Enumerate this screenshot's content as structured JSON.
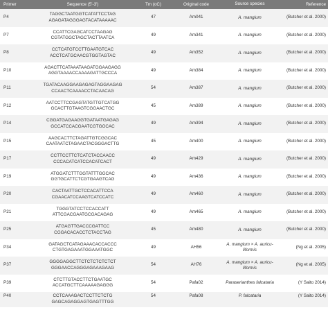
{
  "headers": {
    "primer": "Primer",
    "sequence": "Sequence (5'-3')",
    "tm": "Tm (oC)",
    "code": "Original code",
    "species": "Source species",
    "reference": "Reference"
  },
  "rows": [
    {
      "primer": "P4",
      "seq1": "TAGGCTAATGGTCATATTCCTAG",
      "seq2": "AGAGATAGGGAGTACATAAAAAC",
      "tm": "47",
      "code": "Am041",
      "species": "A. mangium",
      "ref": "(Butcher et al. 2000)"
    },
    {
      "primer": "P7",
      "seq1": "CCATTCGAGCATCCTAAGAG",
      "seq2": "CGTATGGCTAGCTACTTAATCA",
      "tm": "49",
      "code": "Am341",
      "species": "A. mangium",
      "ref": "(Butcher et al. 2000)"
    },
    {
      "primer": "P8",
      "seq1": "CCTCATGTCCTTGAATGTCAC",
      "seq2": "ACCTCATGCAACGTGGTAGTAC",
      "tm": "49",
      "code": "Am352",
      "species": "A. mangium",
      "ref": "(Butcher et al. 2000)"
    },
    {
      "primer": "P10",
      "seq1": "AGACTTCATAAATAAGATGGAAGAGG",
      "seq2": "AGGTAAAACCAAAAGATTGCCCA",
      "tm": "49",
      "code": "Am384",
      "species": "A. mangium",
      "ref": "(Butcher et al. 2000)"
    },
    {
      "primer": "P11",
      "seq1": "TGATACAAGGAAGAGAGTAGGAAGAG",
      "seq2": "CCAACTCAAAACCTACAACAG",
      "tm": "54",
      "code": "Am387",
      "species": "A. mangium",
      "ref": "(Butcher et al. 2000)"
    },
    {
      "primer": "P12",
      "seq1": "AATCCTTCCGAGTATGTTGTCATGG",
      "seq2": "GCACTTGTAAGTCGGAACTGC",
      "tm": "45",
      "code": "Am389",
      "species": "A. mangium",
      "ref": "(Butcher et al. 2000)"
    },
    {
      "primer": "P14",
      "seq1": "CGGATGAGAAGGTGATAATGAGAG",
      "seq2": "GCCATCCACGAATCGTGGCAC",
      "tm": "49",
      "code": "Am394",
      "species": "A. mangium",
      "ref": "(Butcher et al. 2000)"
    },
    {
      "primer": "P15",
      "seq1": "AAGCACTTCTAGATTGTCGGCAC",
      "seq2": "CAATAATCTAGAACTACGGGACTTG",
      "tm": "45",
      "code": "Am400",
      "species": "A. mangium",
      "ref": "(Butcher et al. 2000)"
    },
    {
      "primer": "P17",
      "seq1": "CCTTCCTTCTCATCTACCAACC",
      "seq2": "CCCACATCATCCACATCACT",
      "tm": "49",
      "code": "Am429",
      "species": "A. mangium",
      "ref": "(Butcher et al. 2000)"
    },
    {
      "primer": "P19",
      "seq1": "ATGGATCTTTGGTATTTGGCAC",
      "seq2": "GGTGCATTCTCGTGAAGTCAG",
      "tm": "49",
      "code": "Am436",
      "species": "A. mangium",
      "ref": "(Butcher et al. 2000)"
    },
    {
      "primer": "P20",
      "seq1": "CACTAATTGCTCCACATTCCA",
      "seq2": "CGAACATCCAAGTCATCCATC",
      "tm": "49",
      "code": "Am460",
      "species": "A. mangium",
      "ref": "(Butcher et al. 2000)"
    },
    {
      "primer": "P21",
      "seq1": "TGGGTATCCTCCACCATT",
      "seq2": "ATTCGACGAATGCGACAGAG",
      "tm": "49",
      "code": "Am465",
      "species": "A. mangium",
      "ref": "(Butcher et al. 2000)"
    },
    {
      "primer": "P25",
      "seq1": "ATGAGTTGACCCGATTCC",
      "seq2": "CGGACACACCTCTACCTAG",
      "tm": "45",
      "code": "Am480",
      "species": "A. mangium",
      "ref": "(Butcher et al. 2000)"
    },
    {
      "primer": "P34",
      "seq1": "GATAGCTCATAGAAACACCACCC",
      "seq2": "CTGTGAGAAATGGAAATGGC",
      "tm": "49",
      "code": "AH56",
      "species": "A. mangium × A. auricu-liformis",
      "ref": "(Ng et al. 2005)"
    },
    {
      "primer": "P37",
      "seq1": "GGGGAGGCTTCTCTCTCTCTCT",
      "seq2": "GGGAACCAGGGAGAAAGAAG",
      "tm": "54",
      "code": "AH76",
      "species": "A. mangium × A. auricu-liformis",
      "ref": "(Ng et al. 2005)"
    },
    {
      "primer": "P39",
      "seq1": "CTCTTGTACCTTCTGAATGC",
      "seq2": "ACCATGCTTCAAAAAGAGGG",
      "tm": "54",
      "code": "Pafa02",
      "species": "Paraserianthes falcataria",
      "ref": "(Y Saito 2014)"
    },
    {
      "primer": "P40",
      "seq1": "CCTCAAAGACTCCTTCTCTG",
      "seq2": "GAGCAGAGGAGTGAGTTTGG",
      "tm": "54",
      "code": "Pafa08",
      "species": "P. falcataria",
      "ref": "(Y Saito 2014)"
    }
  ]
}
